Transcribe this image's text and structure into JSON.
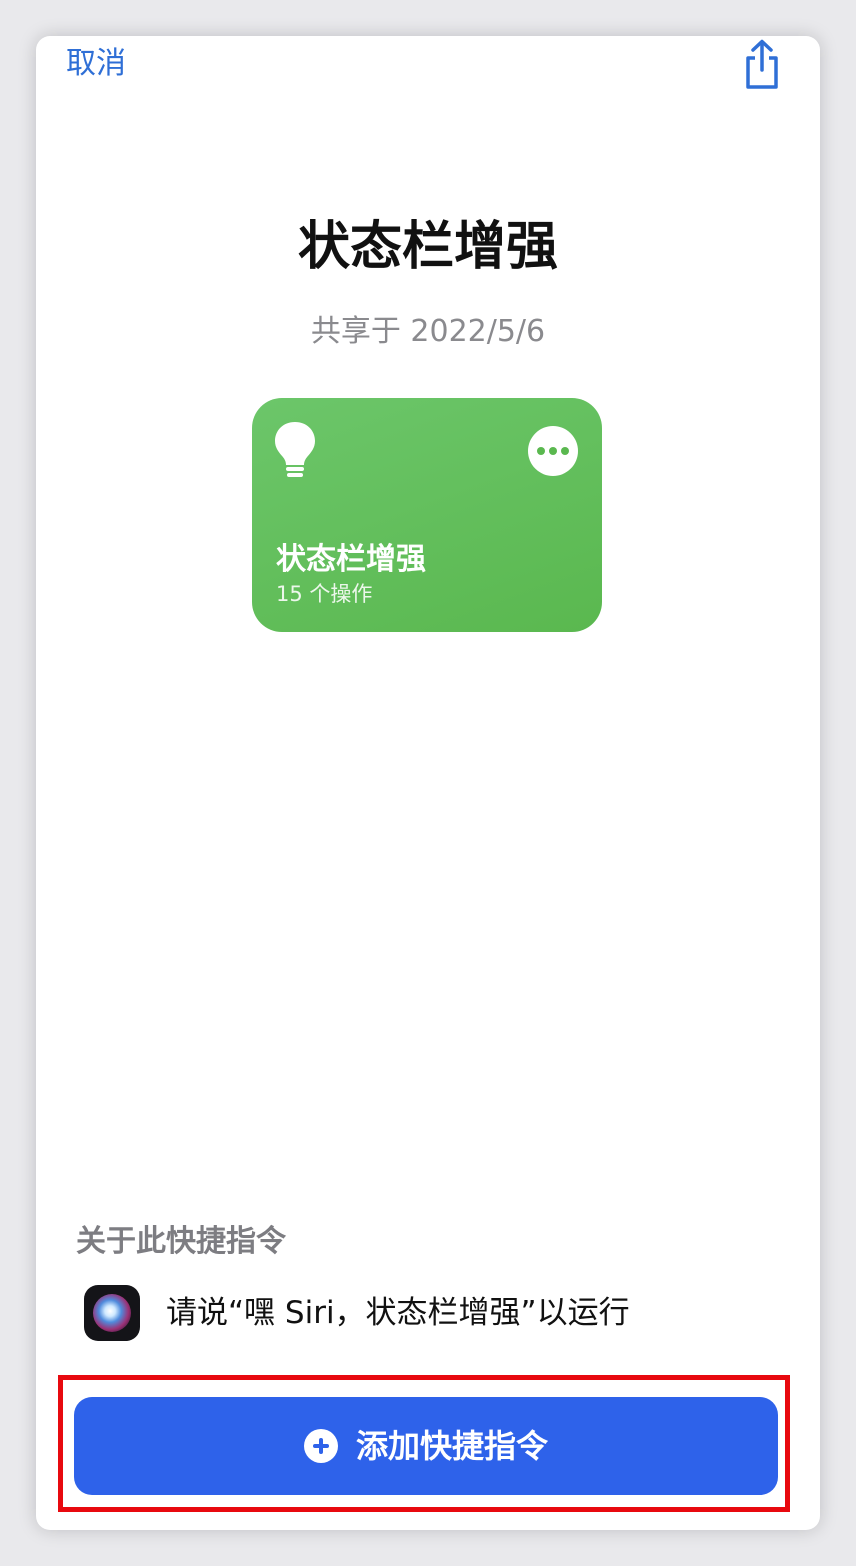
{
  "header": {
    "cancel_label": "取消",
    "share_icon": "share-icon"
  },
  "shortcut": {
    "title": "状态栏增强",
    "shared_date": "共享于 2022/5/6",
    "card": {
      "icon": "lightbulb-icon",
      "name": "状态栏增强",
      "actions_count": "15 个操作",
      "more_icon": "ellipsis-icon",
      "color": "#5ab84f"
    }
  },
  "about": {
    "section_title": "关于此快捷指令",
    "siri_icon": "siri-icon",
    "siri_phrase": "请说“嘿 Siri，状态栏增强”以运行"
  },
  "footer": {
    "add_label": "添加快捷指令",
    "add_icon": "plus-circle-icon",
    "button_color": "#2e62ea",
    "highlight_color": "#e8090f"
  }
}
